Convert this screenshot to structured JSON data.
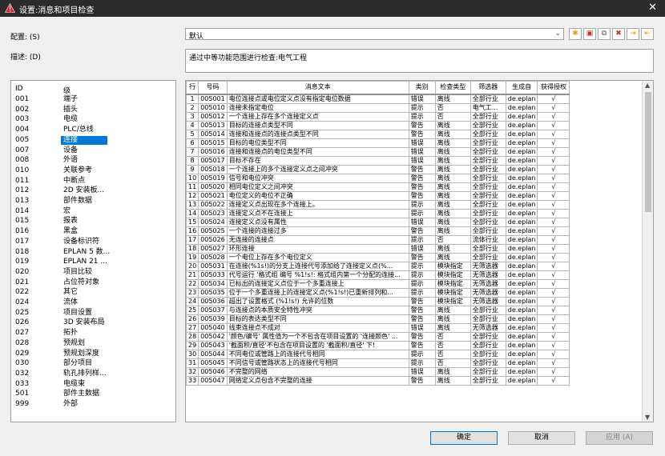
{
  "window": {
    "title": "设置:消息和项目检查",
    "close_glyph": "✕"
  },
  "config": {
    "label": "配置: (S)",
    "value": "默认"
  },
  "description": {
    "label": "描述: (D)",
    "value": "通过中等功能范围进行检查:电气工程"
  },
  "toolbar": [
    "✱",
    "▣",
    "⧉",
    "✖",
    "⇥",
    "⇤"
  ],
  "categories": {
    "header": {
      "id": "ID",
      "level": "级"
    },
    "rows": [
      [
        "001",
        "端子"
      ],
      [
        "002",
        "插头"
      ],
      [
        "003",
        "电缆"
      ],
      [
        "004",
        "PLC/总线"
      ],
      [
        "005",
        "连接"
      ],
      [
        "007",
        "设备"
      ],
      [
        "008",
        "外语"
      ],
      [
        "010",
        "关联参考"
      ],
      [
        "011",
        "中断点"
      ],
      [
        "012",
        "2D 安装板..."
      ],
      [
        "013",
        "部件数据"
      ],
      [
        "014",
        "宏"
      ],
      [
        "015",
        "报表"
      ],
      [
        "016",
        "黑盒"
      ],
      [
        "017",
        "设备标识符"
      ],
      [
        "018",
        "EPLAN 5 数..."
      ],
      [
        "019",
        "EPLAN 21 ..."
      ],
      [
        "020",
        "项目比较"
      ],
      [
        "021",
        "占位符对象"
      ],
      [
        "022",
        "其它"
      ],
      [
        "024",
        "流体"
      ],
      [
        "025",
        "项目设置"
      ],
      [
        "026",
        "3D 安装布局"
      ],
      [
        "027",
        "拓扑"
      ],
      [
        "028",
        "预规划"
      ],
      [
        "029",
        "预规划深度"
      ],
      [
        "030",
        "部分项目"
      ],
      [
        "032",
        "轨孔排列样..."
      ],
      [
        "033",
        "电缆束"
      ],
      [
        "501",
        "部件主数据"
      ],
      [
        "999",
        "外部"
      ]
    ],
    "selected_index": 4
  },
  "grid": {
    "headers": [
      "行",
      "号码",
      "消息文本",
      "类别",
      "检查类型",
      "筛选器",
      "生成自",
      "获得授权"
    ],
    "rows": [
      [
        "1",
        "005001",
        "电位连接点或电位定义点没有指定电位数据",
        "错误",
        "离线",
        "全部行业",
        "de.eplan",
        "√"
      ],
      [
        "2",
        "005010",
        "连接未指定电位",
        "提示",
        "否",
        "电气工...",
        "de.eplan",
        "√"
      ],
      [
        "3",
        "005012",
        "一个连接上存在多个连接定义点",
        "提示",
        "否",
        "全部行业",
        "de.eplan",
        "√"
      ],
      [
        "4",
        "005013",
        "目标的连接点类型不同",
        "警告",
        "离线",
        "全部行业",
        "de.eplan",
        "√"
      ],
      [
        "5",
        "005014",
        "连接和连接点的连接点类型不同",
        "警告",
        "离线",
        "全部行业",
        "de.eplan",
        "√"
      ],
      [
        "6",
        "005015",
        "目标的电位类型不同",
        "错误",
        "离线",
        "全部行业",
        "de.eplan",
        "√"
      ],
      [
        "7",
        "005016",
        "连接和连接点的电位类型不同",
        "错误",
        "离线",
        "全部行业",
        "de.eplan",
        "√"
      ],
      [
        "8",
        "005017",
        "目标不存在",
        "错误",
        "离线",
        "全部行业",
        "de.eplan",
        "√"
      ],
      [
        "9",
        "005018",
        "一个连接上的多个连接定义点之间冲突",
        "警告",
        "离线",
        "全部行业",
        "de.eplan",
        "√"
      ],
      [
        "10",
        "005019",
        "信号和电位冲突",
        "警告",
        "离线",
        "全部行业",
        "de.eplan",
        "√"
      ],
      [
        "11",
        "005020",
        "相同电位定义之间冲突",
        "警告",
        "离线",
        "全部行业",
        "de.eplan",
        "√"
      ],
      [
        "12",
        "005021",
        "电位定义的电位不正确",
        "警告",
        "离线",
        "全部行业",
        "de.eplan",
        "√"
      ],
      [
        "13",
        "005022",
        "连接定义点出现在多个连接上。",
        "提示",
        "离线",
        "全部行业",
        "de.eplan",
        "√"
      ],
      [
        "14",
        "005023",
        "连接定义点不在连接上",
        "提示",
        "离线",
        "全部行业",
        "de.eplan",
        "√"
      ],
      [
        "15",
        "005024",
        "连接定义点没有属性",
        "错误",
        "离线",
        "全部行业",
        "de.eplan",
        "√"
      ],
      [
        "16",
        "005025",
        "一个连接的连接过多",
        "警告",
        "离线",
        "全部行业",
        "de.eplan",
        "√"
      ],
      [
        "17",
        "005026",
        "无连接的连接点",
        "提示",
        "否",
        "流体行业",
        "de.eplan",
        "√"
      ],
      [
        "18",
        "005027",
        "环形连接",
        "错误",
        "离线",
        "全部行业",
        "de.eplan",
        "√"
      ],
      [
        "19",
        "005028",
        "一个电位上存在多个电位定义",
        "警告",
        "离线",
        "全部行业",
        "de.eplan",
        "√"
      ],
      [
        "20",
        "005031",
        "在连接(%1s!)的分支上连接代号添加给了连接定义点(%...",
        "提示",
        "模块指定",
        "无筛选器",
        "de.eplan",
        "√"
      ],
      [
        "21",
        "005033",
        "代号运行 '格式组 编号 %1!s!: 格式组内第一个分配的连接...",
        "提示",
        "模块指定",
        "无筛选器",
        "de.eplan",
        "√"
      ],
      [
        "22",
        "005034",
        "已标出的连接定义点位于一个多重连接上",
        "提示",
        "模块指定",
        "无筛选器",
        "de.eplan",
        "√"
      ],
      [
        "23",
        "005035",
        "位于一个多重连接上的连接定义点(%1!s!)已重新排列和...",
        "提示",
        "模块指定",
        "无筛选器",
        "de.eplan",
        "√"
      ],
      [
        "24",
        "005036",
        "超出了设置格式 (%1!s!) 允许的位数",
        "警告",
        "模块指定",
        "无筛选器",
        "de.eplan",
        "√"
      ],
      [
        "25",
        "005037",
        "与连接点的本质安全特性冲突",
        "警告",
        "离线",
        "全部行业",
        "de.eplan",
        "√"
      ],
      [
        "26",
        "005039",
        "目标的表达类型不同",
        "警告",
        "离线",
        "全部行业",
        "de.eplan",
        "√"
      ],
      [
        "27",
        "005040",
        "线束连接点不成对",
        "错误",
        "离线",
        "无筛选器",
        "de.eplan",
        "√"
      ],
      [
        "28",
        "005042",
        "'颜色/编号' 属性值为一个不包含在项目设置的 '连接颜色' ...",
        "警告",
        "否",
        "全部行业",
        "de.eplan",
        "√"
      ],
      [
        "29",
        "005043",
        "'截面积/直径'不包含在项目设置的 '截面积/直径' 下!",
        "警告",
        "否",
        "全部行业",
        "de.eplan",
        "√"
      ],
      [
        "30",
        "005044",
        "不同电位或管路上的连接代号相同",
        "提示",
        "否",
        "全部行业",
        "de.eplan",
        "√"
      ],
      [
        "31",
        "005045",
        "不同信号或管路状态上的连接代号相同",
        "提示",
        "否",
        "全部行业",
        "de.eplan",
        "√"
      ],
      [
        "32",
        "005046",
        "不完整的网络",
        "错误",
        "离线",
        "全部行业",
        "de.eplan",
        "√"
      ],
      [
        "33",
        "005047",
        "网络定义点包含不完整的连接",
        "警告",
        "离线",
        "全部行业",
        "de.eplan",
        "√"
      ]
    ]
  },
  "buttons": {
    "ok": "确定",
    "cancel": "取消",
    "apply": "应用 (A)"
  }
}
